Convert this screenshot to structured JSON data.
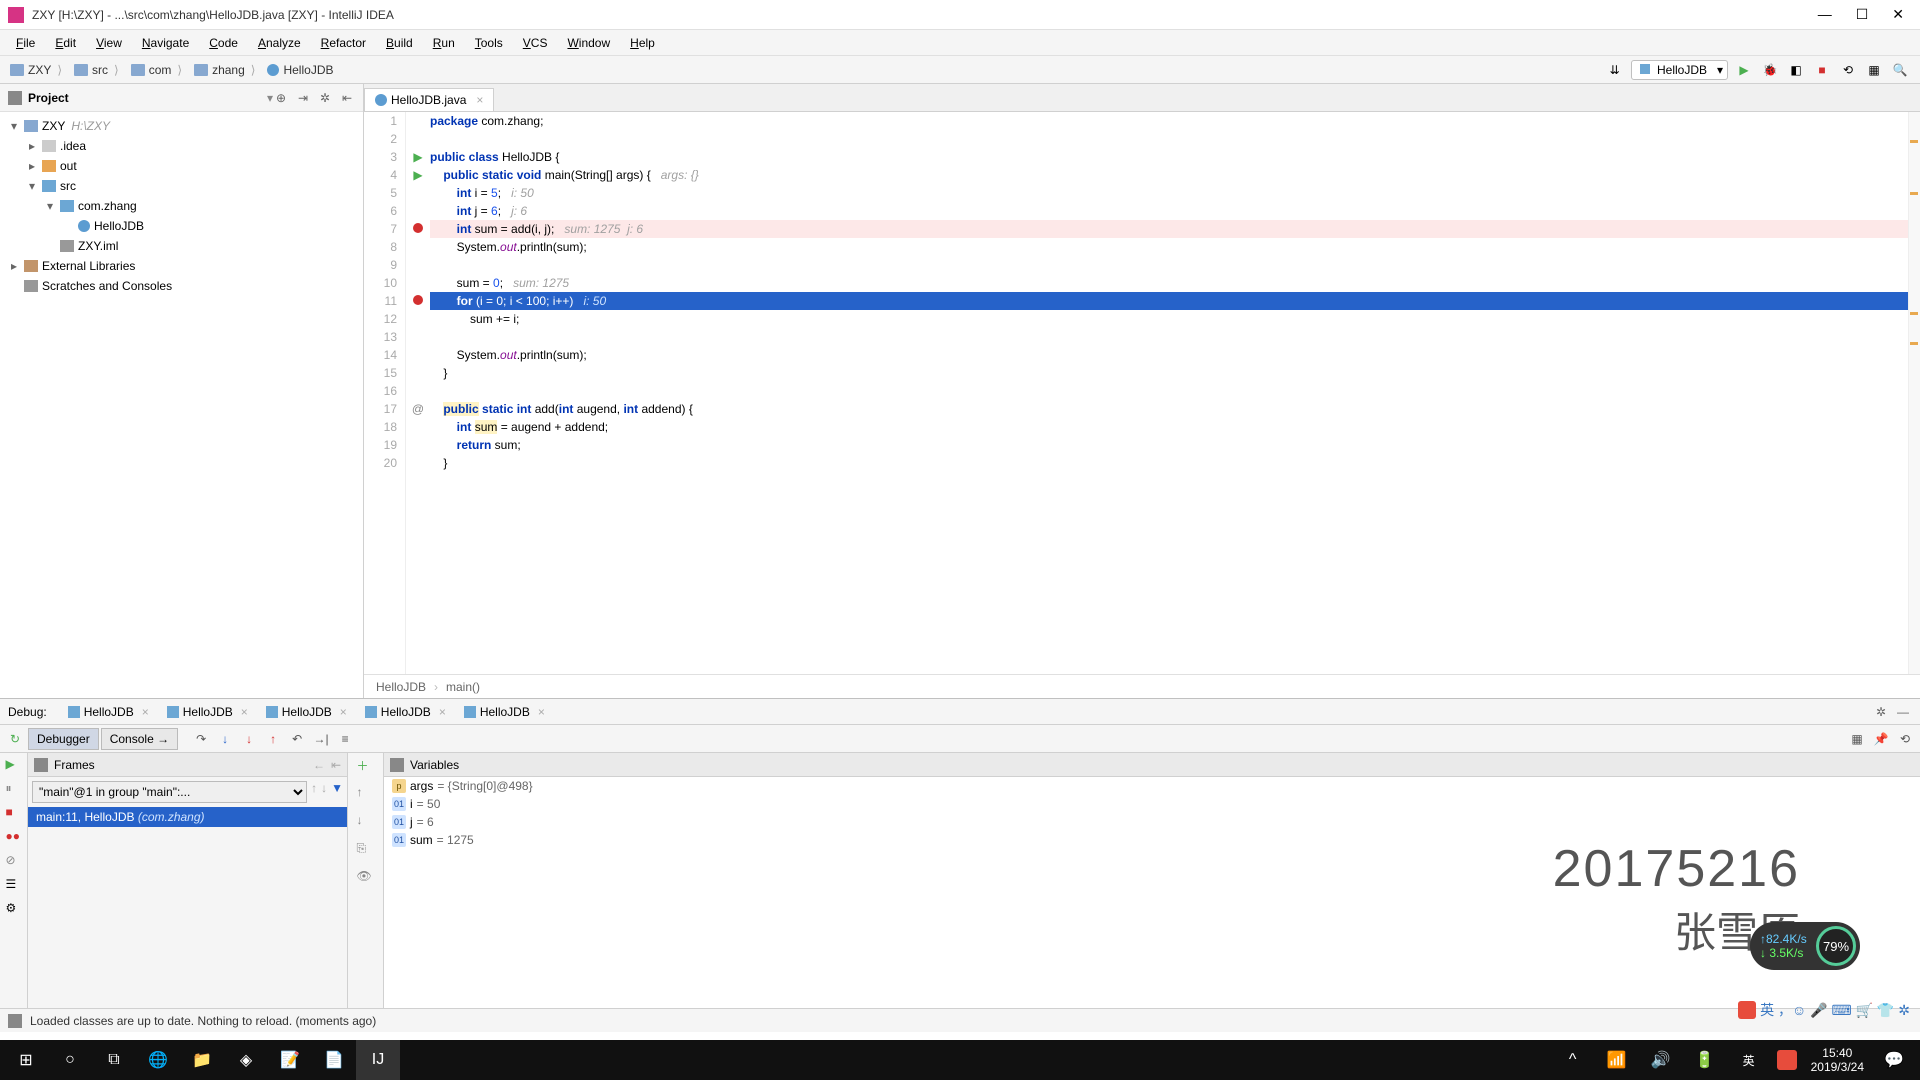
{
  "title": "ZXY [H:\\ZXY] - ...\\src\\com\\zhang\\HelloJDB.java [ZXY] - IntelliJ IDEA",
  "menu": [
    "File",
    "Edit",
    "View",
    "Navigate",
    "Code",
    "Analyze",
    "Refactor",
    "Build",
    "Run",
    "Tools",
    "VCS",
    "Window",
    "Help"
  ],
  "breadcrumb": [
    {
      "icon": "mod",
      "label": "ZXY"
    },
    {
      "icon": "fold-bl",
      "label": "src"
    },
    {
      "icon": "fold-bl",
      "label": "com"
    },
    {
      "icon": "fold-bl",
      "label": "zhang"
    },
    {
      "icon": "jf",
      "label": "HelloJDB"
    }
  ],
  "run_config": "HelloJDB",
  "project": {
    "label": "Project",
    "tree": [
      {
        "depth": 0,
        "arrow": "▾",
        "icon": "mod",
        "label": "ZXY",
        "hint": "H:\\ZXY"
      },
      {
        "depth": 1,
        "arrow": "▸",
        "icon": "fold-gr",
        "label": ".idea"
      },
      {
        "depth": 1,
        "arrow": "▸",
        "icon": "fold-or",
        "label": "out"
      },
      {
        "depth": 1,
        "arrow": "▾",
        "icon": "fold-bl",
        "label": "src"
      },
      {
        "depth": 2,
        "arrow": "▾",
        "icon": "fold-bl",
        "label": "com.zhang"
      },
      {
        "depth": 3,
        "arrow": "",
        "icon": "jf",
        "label": "HelloJDB"
      },
      {
        "depth": 2,
        "arrow": "",
        "icon": "iml",
        "label": "ZXY.iml"
      },
      {
        "depth": 0,
        "arrow": "▸",
        "icon": "lib",
        "label": "External Libraries"
      },
      {
        "depth": 0,
        "arrow": "",
        "icon": "scr",
        "label": "Scratches and Consoles"
      }
    ]
  },
  "editor_tab": "HelloJDB.java",
  "code": {
    "lines": [
      {
        "n": 1,
        "html": "<span class='kw'>package</span> com.zhang;"
      },
      {
        "n": 2,
        "html": ""
      },
      {
        "n": 3,
        "gut": "run",
        "html": "<span class='kw'>public class</span> HelloJDB {"
      },
      {
        "n": 4,
        "gut": "run",
        "html": "    <span class='kw'>public static void</span> main(String[] args) {   <span class='hint'>args: {}</span>"
      },
      {
        "n": 5,
        "html": "        <span class='kw'>int</span> i = <span class='num'>5</span>;   <span class='hint'>i: 50</span>"
      },
      {
        "n": 6,
        "html": "        <span class='kw'>int</span> j = <span class='num'>6</span>;   <span class='hint'>j: 6</span>"
      },
      {
        "n": 7,
        "cls": "hl-err",
        "gut": "bp",
        "html": "        <span class='kw'>int</span> sum = <span>add</span>(i, j);   <span class='hint'>sum: 1275  j: 6</span>"
      },
      {
        "n": 8,
        "html": "        System.<span class='fld'>out</span>.println(sum);"
      },
      {
        "n": 9,
        "html": ""
      },
      {
        "n": 10,
        "html": "        sum = <span class='num'>0</span>;   <span class='hint'>sum: 1275</span>"
      },
      {
        "n": 11,
        "cls": "hl-sel",
        "gut": "bp",
        "html": "        <span class='kw'>for</span> (i = <span class='num'>0</span>; i &lt; <span class='num'>100</span>; i++)   <span class='hint'>i: 50</span>"
      },
      {
        "n": 12,
        "html": "            sum += i;"
      },
      {
        "n": 13,
        "html": ""
      },
      {
        "n": 14,
        "html": "        System.<span class='fld'>out</span>.println(sum);"
      },
      {
        "n": 15,
        "html": "    }"
      },
      {
        "n": 16,
        "html": ""
      },
      {
        "n": 17,
        "gut": "at",
        "html": "    <span class='hlw'><span class='kw'>public</span></span> <span class='kw'>static int</span> add(<span class='kw'>int</span> augend, <span class='kw'>int</span> addend) {"
      },
      {
        "n": 18,
        "html": "        <span class='kw'>int</span> <span class='hlw'>sum</span> = augend + addend;"
      },
      {
        "n": 19,
        "html": "        <span class='kw'>return</span> sum;"
      },
      {
        "n": 20,
        "html": "    }"
      }
    ],
    "breadcrumb": [
      "HelloJDB",
      "main()"
    ]
  },
  "debug": {
    "label": "Debug:",
    "tabs": [
      "HelloJDB",
      "HelloJDB",
      "HelloJDB",
      "HelloJDB",
      "HelloJDB"
    ],
    "sub": {
      "debugger": "Debugger",
      "console": "Console"
    },
    "frames": {
      "label": "Frames",
      "thread": "\"main\"@1 in group \"main\":...",
      "stack": {
        "loc": "main:11, HelloJDB",
        "pkg": "(com.zhang)"
      }
    },
    "vars": {
      "label": "Variables",
      "items": [
        {
          "t": "p",
          "name": "args",
          "val": "= {String[0]@498}"
        },
        {
          "t": "i",
          "name": "i",
          "val": "= 50"
        },
        {
          "t": "i",
          "name": "j",
          "val": "= 6"
        },
        {
          "t": "i",
          "name": "sum",
          "val": "= 1275"
        }
      ]
    }
  },
  "status": "Loaded classes are up to date. Nothing to reload. (moments ago)",
  "watermark": {
    "id": "20175216",
    "name": "张雪原"
  },
  "net": {
    "up": "↑82.4K/s",
    "down": "↓ 3.5K/s",
    "pct": "79%"
  },
  "clock": {
    "time": "15:40",
    "date": "2019/3/24"
  }
}
